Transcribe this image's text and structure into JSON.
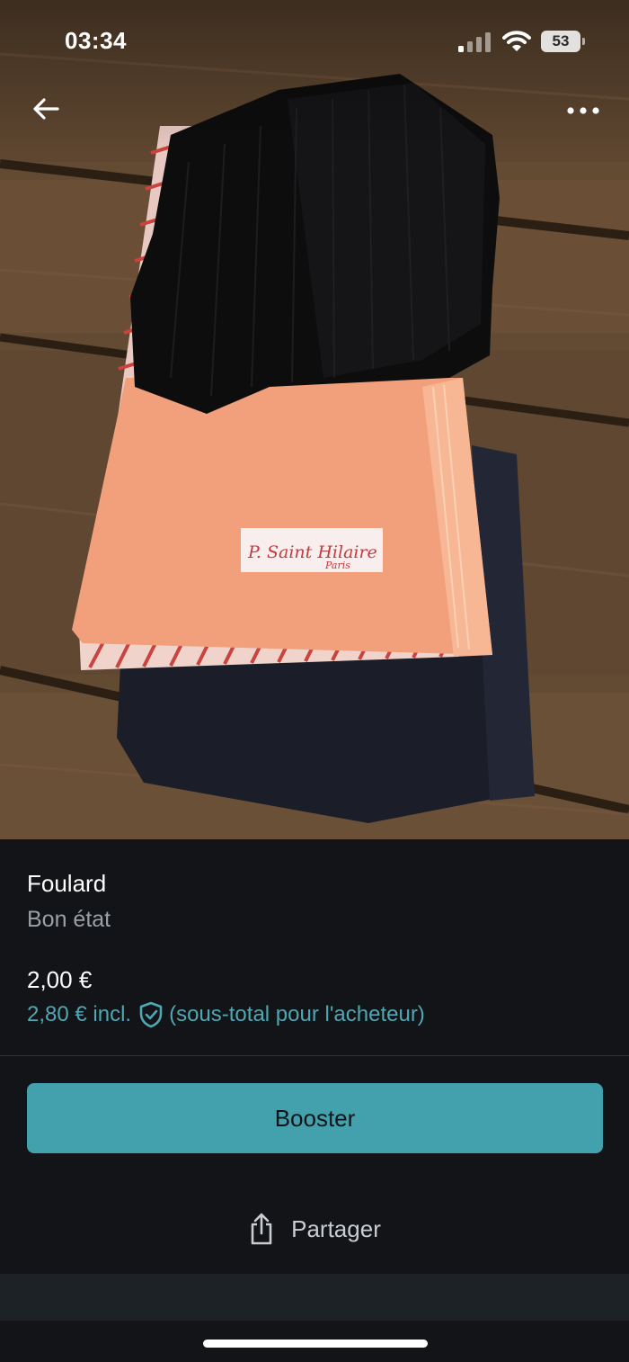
{
  "status_bar": {
    "time": "03:34",
    "battery_level": "53",
    "icons": [
      "signal-icon",
      "wifi-icon",
      "battery-icon"
    ]
  },
  "nav": {
    "back_icon": "arrow-left-icon",
    "more_icon": "more-horizontal-icon"
  },
  "photo": {
    "brand_label_text": "P. Saint Hilaire Paris"
  },
  "item": {
    "title": "Foulard",
    "condition": "Bon état",
    "price": "2,00 €",
    "buyer_price": "2,80 € incl.",
    "buyer_note": "(sous-total pour l'acheteur)"
  },
  "actions": {
    "booster_label": "Booster",
    "share_label": "Partager",
    "share_icon": "share-icon"
  },
  "colors": {
    "accent": "#43a1ad",
    "accent_text": "#4fa7b4",
    "background": "#121417"
  }
}
